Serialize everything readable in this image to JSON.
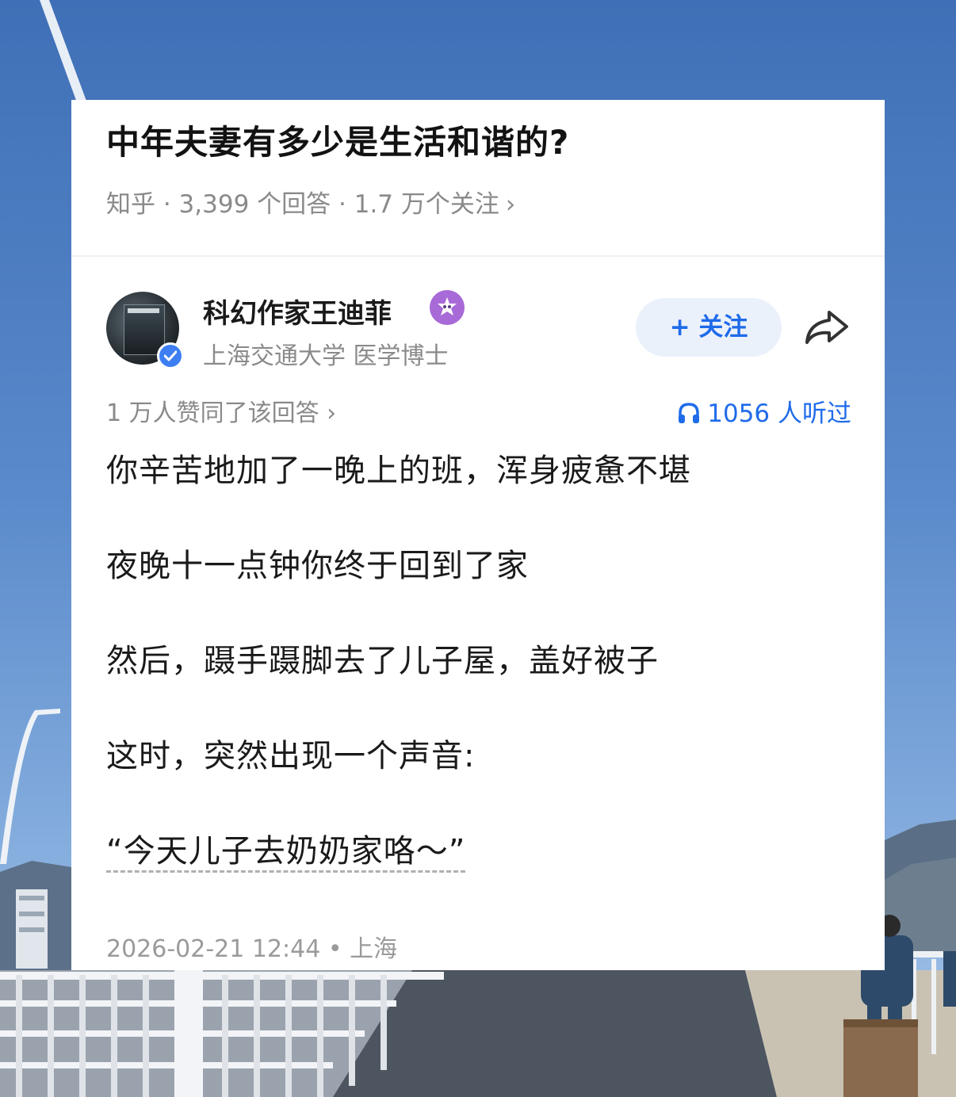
{
  "question": {
    "title": "中年夫妻有多少是生活和谐的?",
    "meta": "知乎 · 3,399 个回答 · 1.7 万个关注",
    "chevron": "›"
  },
  "author": {
    "name": "科幻作家王迪菲",
    "subtitle": "上海交通大学 医学博士",
    "follow_label": "+ 关注"
  },
  "stats": {
    "upvote_text": "1 万人赞同了该回答 ›",
    "listened_text": "1056 人听过"
  },
  "content": {
    "lines": [
      "你辛苦地加了一晚上的班，浑身疲惫不堪",
      "夜晚十一点钟你终于回到了家",
      "然后，蹑手蹑脚去了儿子屋，盖好被子",
      "这时，突然出现一个声音:",
      "“今天儿子去奶奶家咯～”"
    ]
  },
  "footer": {
    "timestamp_location": "2026-02-21 12:44 • 上海"
  },
  "colors": {
    "accent": "#1f6bea",
    "follow_bg": "#ebf1fb",
    "meta_gray": "#8a8a8a",
    "verified_blue": "#3d7ff3",
    "badge_purple": "#a86ad7"
  },
  "icons": {
    "verified": "verified-check-icon",
    "badge": "creator-badge-icon",
    "share": "share-arrow-icon",
    "headphones": "headphones-icon"
  }
}
